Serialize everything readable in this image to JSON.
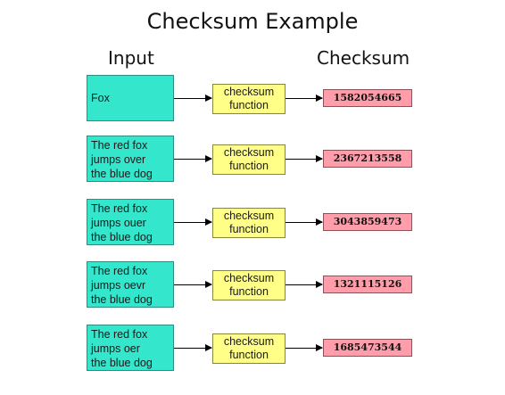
{
  "title": "Checksum Example",
  "headers": {
    "input": "Input",
    "checksum": "Checksum"
  },
  "rows": [
    {
      "input_lines": [
        "Fox"
      ],
      "func_lines": [
        "checksum",
        "function"
      ],
      "checksum": "1582054665"
    },
    {
      "input_lines": [
        "The red fox",
        "jumps over",
        "the blue dog"
      ],
      "func_lines": [
        "checksum",
        "function"
      ],
      "checksum": "2367213558"
    },
    {
      "input_lines": [
        "The red fox",
        "jumps ouer",
        "the blue dog"
      ],
      "func_lines": [
        "checksum",
        "function"
      ],
      "checksum": "3043859473"
    },
    {
      "input_lines": [
        "The red fox",
        "jumps oevr",
        "the blue dog"
      ],
      "func_lines": [
        "checksum",
        "function"
      ],
      "checksum": "1321115126"
    },
    {
      "input_lines": [
        "The red fox",
        "jumps oer",
        "the blue dog"
      ],
      "func_lines": [
        "checksum",
        "function"
      ],
      "checksum": "1685473544"
    }
  ],
  "colors": {
    "input_fill": "#33e6cc",
    "function_fill": "#ffff88",
    "checksum_fill": "#ff9eaa"
  }
}
